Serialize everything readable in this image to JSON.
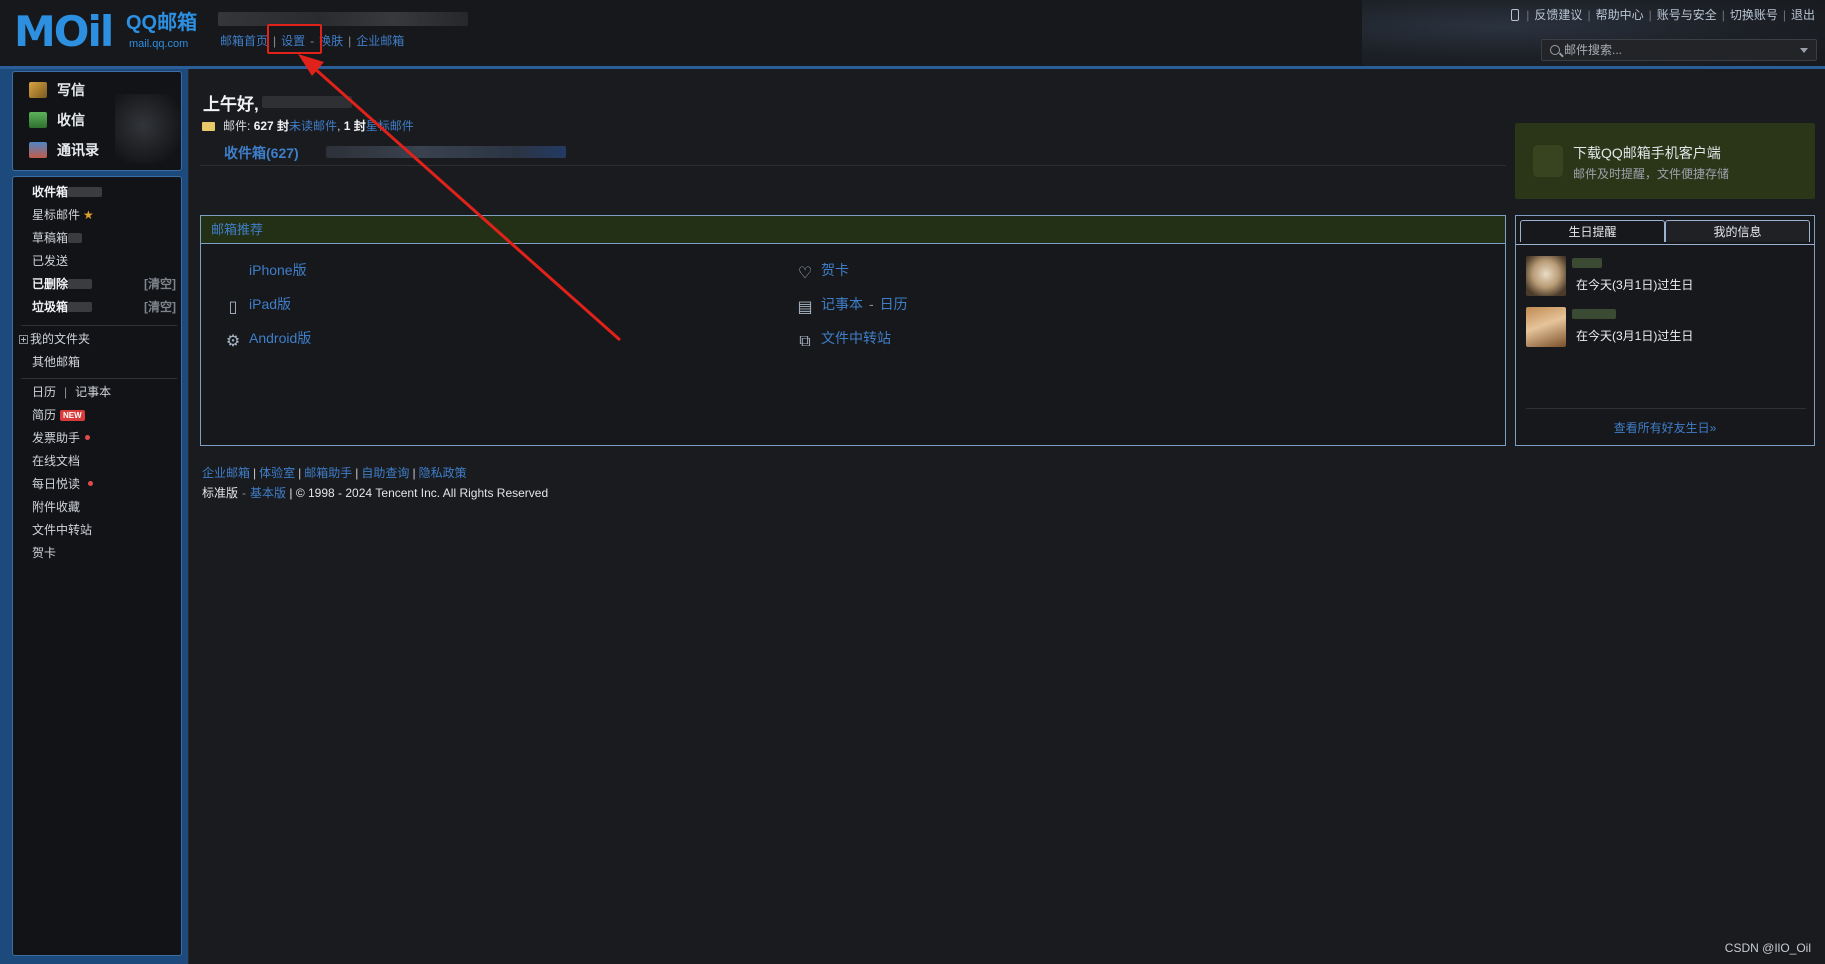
{
  "header": {
    "logo_text": "MOil",
    "logo_brand": "QQ邮箱",
    "logo_domain": "mail.qq.com",
    "nav": [
      {
        "label": "邮箱首页"
      },
      {
        "label": "设置"
      },
      {
        "label": "换肤"
      },
      {
        "label": "企业邮箱"
      }
    ],
    "top_links": [
      "反馈建议",
      "帮助中心",
      "账号与安全",
      "切换账号",
      "退出"
    ],
    "search_placeholder": "邮件搜索..."
  },
  "sidebar": {
    "compose": [
      {
        "label": "写信"
      },
      {
        "label": "收信"
      },
      {
        "label": "通讯录"
      }
    ],
    "folders": [
      {
        "label": "收件箱"
      },
      {
        "label": "星标邮件"
      },
      {
        "label": "草稿箱"
      },
      {
        "label": "已发送"
      },
      {
        "label": "已删除",
        "action": "[清空]"
      },
      {
        "label": "垃圾箱",
        "action": "[清空]"
      }
    ],
    "my_folders": "我的文件夹",
    "other_mail": "其他邮箱",
    "tools": {
      "calendar": "日历",
      "notes": "记事本",
      "resume": "简历",
      "resume_badge": "NEW",
      "invoice": "发票助手",
      "docs": "在线文档",
      "daily": "每日悦读",
      "attachments": "附件收藏",
      "transfer": "文件中转站",
      "card": "贺卡"
    }
  },
  "main": {
    "greeting": "上午好,",
    "stats": {
      "label": "邮件:",
      "count": "627 封",
      "unread": "未读邮件",
      "starred_count": "1 封",
      "starred": "星标邮件"
    },
    "inbox_link": "收件箱(627)",
    "recommend": {
      "title": "邮箱推荐",
      "left": [
        "iPhone版",
        "iPad版",
        "Android版"
      ],
      "right": {
        "card": "贺卡",
        "notes": "记事本",
        "dash": "-",
        "calendar": "日历",
        "transfer": "文件中转站"
      }
    },
    "footer_links": [
      "企业邮箱",
      "体验室",
      "邮箱助手",
      "自助查询",
      "隐私政策"
    ],
    "copyright": {
      "edition": "标准版",
      "dash": "-",
      "basic": "基本版",
      "text": "| © 1998 - 2024 Tencent Inc. All Rights Reserved"
    }
  },
  "promo": {
    "title": "下载QQ邮箱手机客户端",
    "subtitle": "邮件及时提醒，文件便捷存储"
  },
  "birthday": {
    "tabs": [
      "生日提醒",
      "我的信息"
    ],
    "friends": [
      {
        "message": "在今天(3月1日)过生日"
      },
      {
        "message": "在今天(3月1日)过生日"
      }
    ],
    "more_link": "查看所有好友生日»"
  },
  "watermark": "CSDN @IlO_Oil",
  "colors": {
    "accent_link": "#3f7ec9",
    "annotation_red": "#e0221b",
    "frame_blue": "#1d4a7c"
  }
}
